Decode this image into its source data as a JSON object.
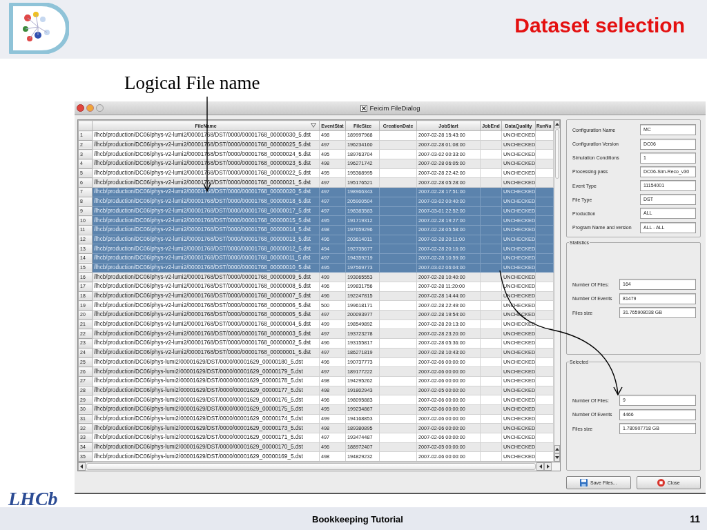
{
  "slide": {
    "title": "Dataset selection",
    "annotation": "Logical File name",
    "footer": "Bookkeeping Tutorial",
    "page_number": "11",
    "logo_text": "LHCb"
  },
  "window": {
    "title": "Feicim FileDialog"
  },
  "table": {
    "columns": [
      "FileName",
      "EventStat",
      "FileSize",
      "CreationDate",
      "JobStart",
      "JobEnd",
      "DataQuality",
      "RunNu"
    ],
    "rows": [
      {
        "number": "1",
        "file": "/lhcb/production/DC06/phys-v2-lumi2/00001768/DST/0000/00001768_00000030_5.dst",
        "event_stat": "498",
        "file_size": "189997968",
        "job_start": "2007-02-28 15:43:00",
        "data_quality": "UNCHECKED",
        "selected": false
      },
      {
        "number": "2",
        "file": "/lhcb/production/DC06/phys-v2-lumi2/00001768/DST/0000/00001768_00000025_5.dst",
        "event_stat": "497",
        "file_size": "196234160",
        "job_start": "2007-02-28 01:08:00",
        "data_quality": "UNCHECKED",
        "selected": false
      },
      {
        "number": "3",
        "file": "/lhcb/production/DC06/phys-v2-lumi2/00001768/DST/0000/00001768_00000024_5.dst",
        "event_stat": "495",
        "file_size": "189763704",
        "job_start": "2007-03-02 00:33:00",
        "data_quality": "UNCHECKED",
        "selected": false
      },
      {
        "number": "4",
        "file": "/lhcb/production/DC06/phys-v2-lumi2/00001768/DST/0000/00001768_00000023_5.dst",
        "event_stat": "498",
        "file_size": "196271742",
        "job_start": "2007-02-28 06:05:00",
        "data_quality": "UNCHECKED",
        "selected": false
      },
      {
        "number": "5",
        "file": "/lhcb/production/DC06/phys-v2-lumi2/00001768/DST/0000/00001768_00000022_5.dst",
        "event_stat": "495",
        "file_size": "195368995",
        "job_start": "2007-02-28 22:42:00",
        "data_quality": "UNCHECKED",
        "selected": false
      },
      {
        "number": "6",
        "file": "/lhcb/production/DC06/phys-v2-lumi2/00001768/DST/0000/00001768_00000021_5.dst",
        "event_stat": "497",
        "file_size": "195176521",
        "job_start": "2007-02-28 05:28:00",
        "data_quality": "UNCHECKED",
        "selected": false
      },
      {
        "number": "7",
        "file": "/lhcb/production/DC06/phys-v2-lumi2/00001768/DST/0000/00001768_00000020_5.dst",
        "event_stat": "497",
        "file_size": "198966343",
        "job_start": "2007-02-28 17:51:00",
        "data_quality": "UNCHECKED",
        "selected": true
      },
      {
        "number": "8",
        "file": "/lhcb/production/DC06/phys-v2-lumi2/00001768/DST/0000/00001768_00000018_5.dst",
        "event_stat": "497",
        "file_size": "205900504",
        "job_start": "2007-03-02 00:40:00",
        "data_quality": "UNCHECKED",
        "selected": true
      },
      {
        "number": "9",
        "file": "/lhcb/production/DC06/phys-v2-lumi2/00001768/DST/0000/00001768_00000017_5.dst",
        "event_stat": "497",
        "file_size": "198383583",
        "job_start": "2007-03-01 22:52:00",
        "data_quality": "UNCHECKED",
        "selected": true
      },
      {
        "number": "10",
        "file": "/lhcb/production/DC06/phys-v2-lumi2/00001768/DST/0000/00001768_00000015_5.dst",
        "event_stat": "495",
        "file_size": "191719312",
        "job_start": "2007-02-28 19:27:00",
        "data_quality": "UNCHECKED",
        "selected": true
      },
      {
        "number": "11",
        "file": "/lhcb/production/DC06/phys-v2-lumi2/00001768/DST/0000/00001768_00000014_5.dst",
        "event_stat": "498",
        "file_size": "197659296",
        "job_start": "2007-02-28 05:58:00",
        "data_quality": "UNCHECKED",
        "selected": true
      },
      {
        "number": "12",
        "file": "/lhcb/production/DC06/phys-v2-lumi2/00001768/DST/0000/00001768_00000013_5.dst",
        "event_stat": "496",
        "file_size": "203614011",
        "job_start": "2007-02-28 20:11:00",
        "data_quality": "UNCHECKED",
        "selected": true
      },
      {
        "number": "13",
        "file": "/lhcb/production/DC06/phys-v2-lumi2/00001768/DST/0000/00001768_00000012_5.dst",
        "event_stat": "494",
        "file_size": "192735677",
        "job_start": "2007-02-28 20:16:00",
        "data_quality": "UNCHECKED",
        "selected": true
      },
      {
        "number": "14",
        "file": "/lhcb/production/DC06/phys-v2-lumi2/00001768/DST/0000/00001768_00000011_5.dst",
        "event_stat": "497",
        "file_size": "194359219",
        "job_start": "2007-02-28 10:59:00",
        "data_quality": "UNCHECKED",
        "selected": true
      },
      {
        "number": "15",
        "file": "/lhcb/production/DC06/phys-v2-lumi2/00001768/DST/0000/00001768_00000010_5.dst",
        "event_stat": "495",
        "file_size": "197569773",
        "job_start": "2007-03-02 06:04:00",
        "data_quality": "UNCHECKED",
        "selected": true
      },
      {
        "number": "16",
        "file": "/lhcb/production/DC06/phys-v2-lumi2/00001768/DST/0000/00001768_00000009_5.dst",
        "event_stat": "499",
        "file_size": "193065553",
        "job_start": "2007-02-28 10:40:00",
        "data_quality": "UNCHECKED",
        "selected": false
      },
      {
        "number": "17",
        "file": "/lhcb/production/DC06/phys-v2-lumi2/00001768/DST/0000/00001768_00000008_5.dst",
        "event_stat": "496",
        "file_size": "199831756",
        "job_start": "2007-02-28 11:20:00",
        "data_quality": "UNCHECKED",
        "selected": false
      },
      {
        "number": "18",
        "file": "/lhcb/production/DC06/phys-v2-lumi2/00001768/DST/0000/00001768_00000007_5.dst",
        "event_stat": "496",
        "file_size": "192247815",
        "job_start": "2007-02-28 14:44:00",
        "data_quality": "UNCHECKED",
        "selected": false
      },
      {
        "number": "19",
        "file": "/lhcb/production/DC06/phys-v2-lumi2/00001768/DST/0000/00001768_00000006_5.dst",
        "event_stat": "500",
        "file_size": "199618171",
        "job_start": "2007-02-28 22:49:00",
        "data_quality": "UNCHECKED",
        "selected": false
      },
      {
        "number": "20",
        "file": "/lhcb/production/DC06/phys-v2-lumi2/00001768/DST/0000/00001768_00000005_5.dst",
        "event_stat": "497",
        "file_size": "200093977",
        "job_start": "2007-02-28 19:54:00",
        "data_quality": "UNCHECKED",
        "selected": false
      },
      {
        "number": "21",
        "file": "/lhcb/production/DC06/phys-v2-lumi2/00001768/DST/0000/00001768_00000004_5.dst",
        "event_stat": "499",
        "file_size": "198549892",
        "job_start": "2007-02-28 20:13:00",
        "data_quality": "UNCHECKED",
        "selected": false
      },
      {
        "number": "22",
        "file": "/lhcb/production/DC06/phys-v2-lumi2/00001768/DST/0000/00001768_00000003_5.dst",
        "event_stat": "497",
        "file_size": "193723278",
        "job_start": "2007-02-28 23:20:00",
        "data_quality": "UNCHECKED",
        "selected": false
      },
      {
        "number": "23",
        "file": "/lhcb/production/DC06/phys-v2-lumi2/00001768/DST/0000/00001768_00000002_5.dst",
        "event_stat": "496",
        "file_size": "193155817",
        "job_start": "2007-02-28 05:36:00",
        "data_quality": "UNCHECKED",
        "selected": false
      },
      {
        "number": "24",
        "file": "/lhcb/production/DC06/phys-v2-lumi2/00001768/DST/0000/00001768_00000001_5.dst",
        "event_stat": "497",
        "file_size": "186271819",
        "job_start": "2007-02-28 10:43:00",
        "data_quality": "UNCHECKED",
        "selected": false
      },
      {
        "number": "25",
        "file": "/lhcb/production/DC06/phys-lumi2/00001629/DST/0000/00001629_00000180_5.dst",
        "event_stat": "496",
        "file_size": "190737773",
        "job_start": "2007-02-06 00:00:00",
        "data_quality": "UNCHECKED",
        "selected": false
      },
      {
        "number": "26",
        "file": "/lhcb/production/DC06/phys-lumi2/00001629/DST/0000/00001629_00000179_5.dst",
        "event_stat": "497",
        "file_size": "189177222",
        "job_start": "2007-02-06 00:00:00",
        "data_quality": "UNCHECKED",
        "selected": false
      },
      {
        "number": "27",
        "file": "/lhcb/production/DC06/phys-lumi2/00001629/DST/0000/00001629_00000178_5.dst",
        "event_stat": "498",
        "file_size": "194295262",
        "job_start": "2007-02-06 00:00:00",
        "data_quality": "UNCHECKED",
        "selected": false
      },
      {
        "number": "28",
        "file": "/lhcb/production/DC06/phys-lumi2/00001629/DST/0000/00001629_00000177_5.dst",
        "event_stat": "498",
        "file_size": "191802943",
        "job_start": "2007-02-05 00:00:00",
        "data_quality": "UNCHECKED",
        "selected": false
      },
      {
        "number": "29",
        "file": "/lhcb/production/DC06/phys-lumi2/00001629/DST/0000/00001629_00000176_5.dst",
        "event_stat": "496",
        "file_size": "198095883",
        "job_start": "2007-02-06 00:00:00",
        "data_quality": "UNCHECKED",
        "selected": false
      },
      {
        "number": "30",
        "file": "/lhcb/production/DC06/phys-lumi2/00001629/DST/0000/00001629_00000175_5.dst",
        "event_stat": "495",
        "file_size": "199234867",
        "job_start": "2007-02-06 00:00:00",
        "data_quality": "UNCHECKED",
        "selected": false
      },
      {
        "number": "31",
        "file": "/lhcb/production/DC06/phys-lumi2/00001629/DST/0000/00001629_00000174_5.dst",
        "event_stat": "499",
        "file_size": "194168853",
        "job_start": "2007-02-06 00:00:00",
        "data_quality": "UNCHECKED",
        "selected": false
      },
      {
        "number": "32",
        "file": "/lhcb/production/DC06/phys-lumi2/00001629/DST/0000/00001629_00000173_5.dst",
        "event_stat": "498",
        "file_size": "189380895",
        "job_start": "2007-02-06 00:00:00",
        "data_quality": "UNCHECKED",
        "selected": false
      },
      {
        "number": "33",
        "file": "/lhcb/production/DC06/phys-lumi2/00001629/DST/0000/00001629_00000171_5.dst",
        "event_stat": "497",
        "file_size": "193474487",
        "job_start": "2007-02-06 00:00:00",
        "data_quality": "UNCHECKED",
        "selected": false
      },
      {
        "number": "34",
        "file": "/lhcb/production/DC06/phys-lumi2/00001629/DST/0000/00001629_00000170_5.dst",
        "event_stat": "496",
        "file_size": "188972407",
        "job_start": "2007-02-05 00:00:00",
        "data_quality": "UNCHECKED",
        "selected": false
      },
      {
        "number": "35",
        "file": "/lhcb/production/DC06/phys-lumi2/00001629/DST/0000/00001629_00000169_5.dst",
        "event_stat": "498",
        "file_size": "194829232",
        "job_start": "2007-02-06 00:00:00",
        "data_quality": "UNCHECKED",
        "selected": false
      }
    ]
  },
  "configuration": [
    {
      "label": "Configuration Name",
      "value": "MC"
    },
    {
      "label": "Configuration Version",
      "value": "DC06"
    },
    {
      "label": "Simulation Conditions",
      "value": "1"
    },
    {
      "label": "Processing pass",
      "value": "DC06-Sim-Reco_v30"
    },
    {
      "label": "Event Type",
      "value": "11154001"
    },
    {
      "label": "File Type",
      "value": "DST"
    },
    {
      "label": "Production",
      "value": "ALL"
    },
    {
      "label": "Program Name and version",
      "value": "ALL - ALL"
    }
  ],
  "statistics": {
    "title": "Statistics",
    "fields": [
      {
        "label": "Number Of Files:",
        "value": "164"
      },
      {
        "label": "Number Of Events",
        "value": "81479"
      },
      {
        "label": "Files size",
        "value": "31.765908038 GB"
      }
    ]
  },
  "selection": {
    "title": "Selected",
    "fields": [
      {
        "label": "Number Of Files:",
        "value": "9"
      },
      {
        "label": "Number Of Events",
        "value": "4466"
      },
      {
        "label": "Files size",
        "value": "1.780907718 GB"
      }
    ]
  },
  "buttons": [
    {
      "label": "Save Files...",
      "kind": "save"
    },
    {
      "label": "Close",
      "kind": "close"
    }
  ]
}
